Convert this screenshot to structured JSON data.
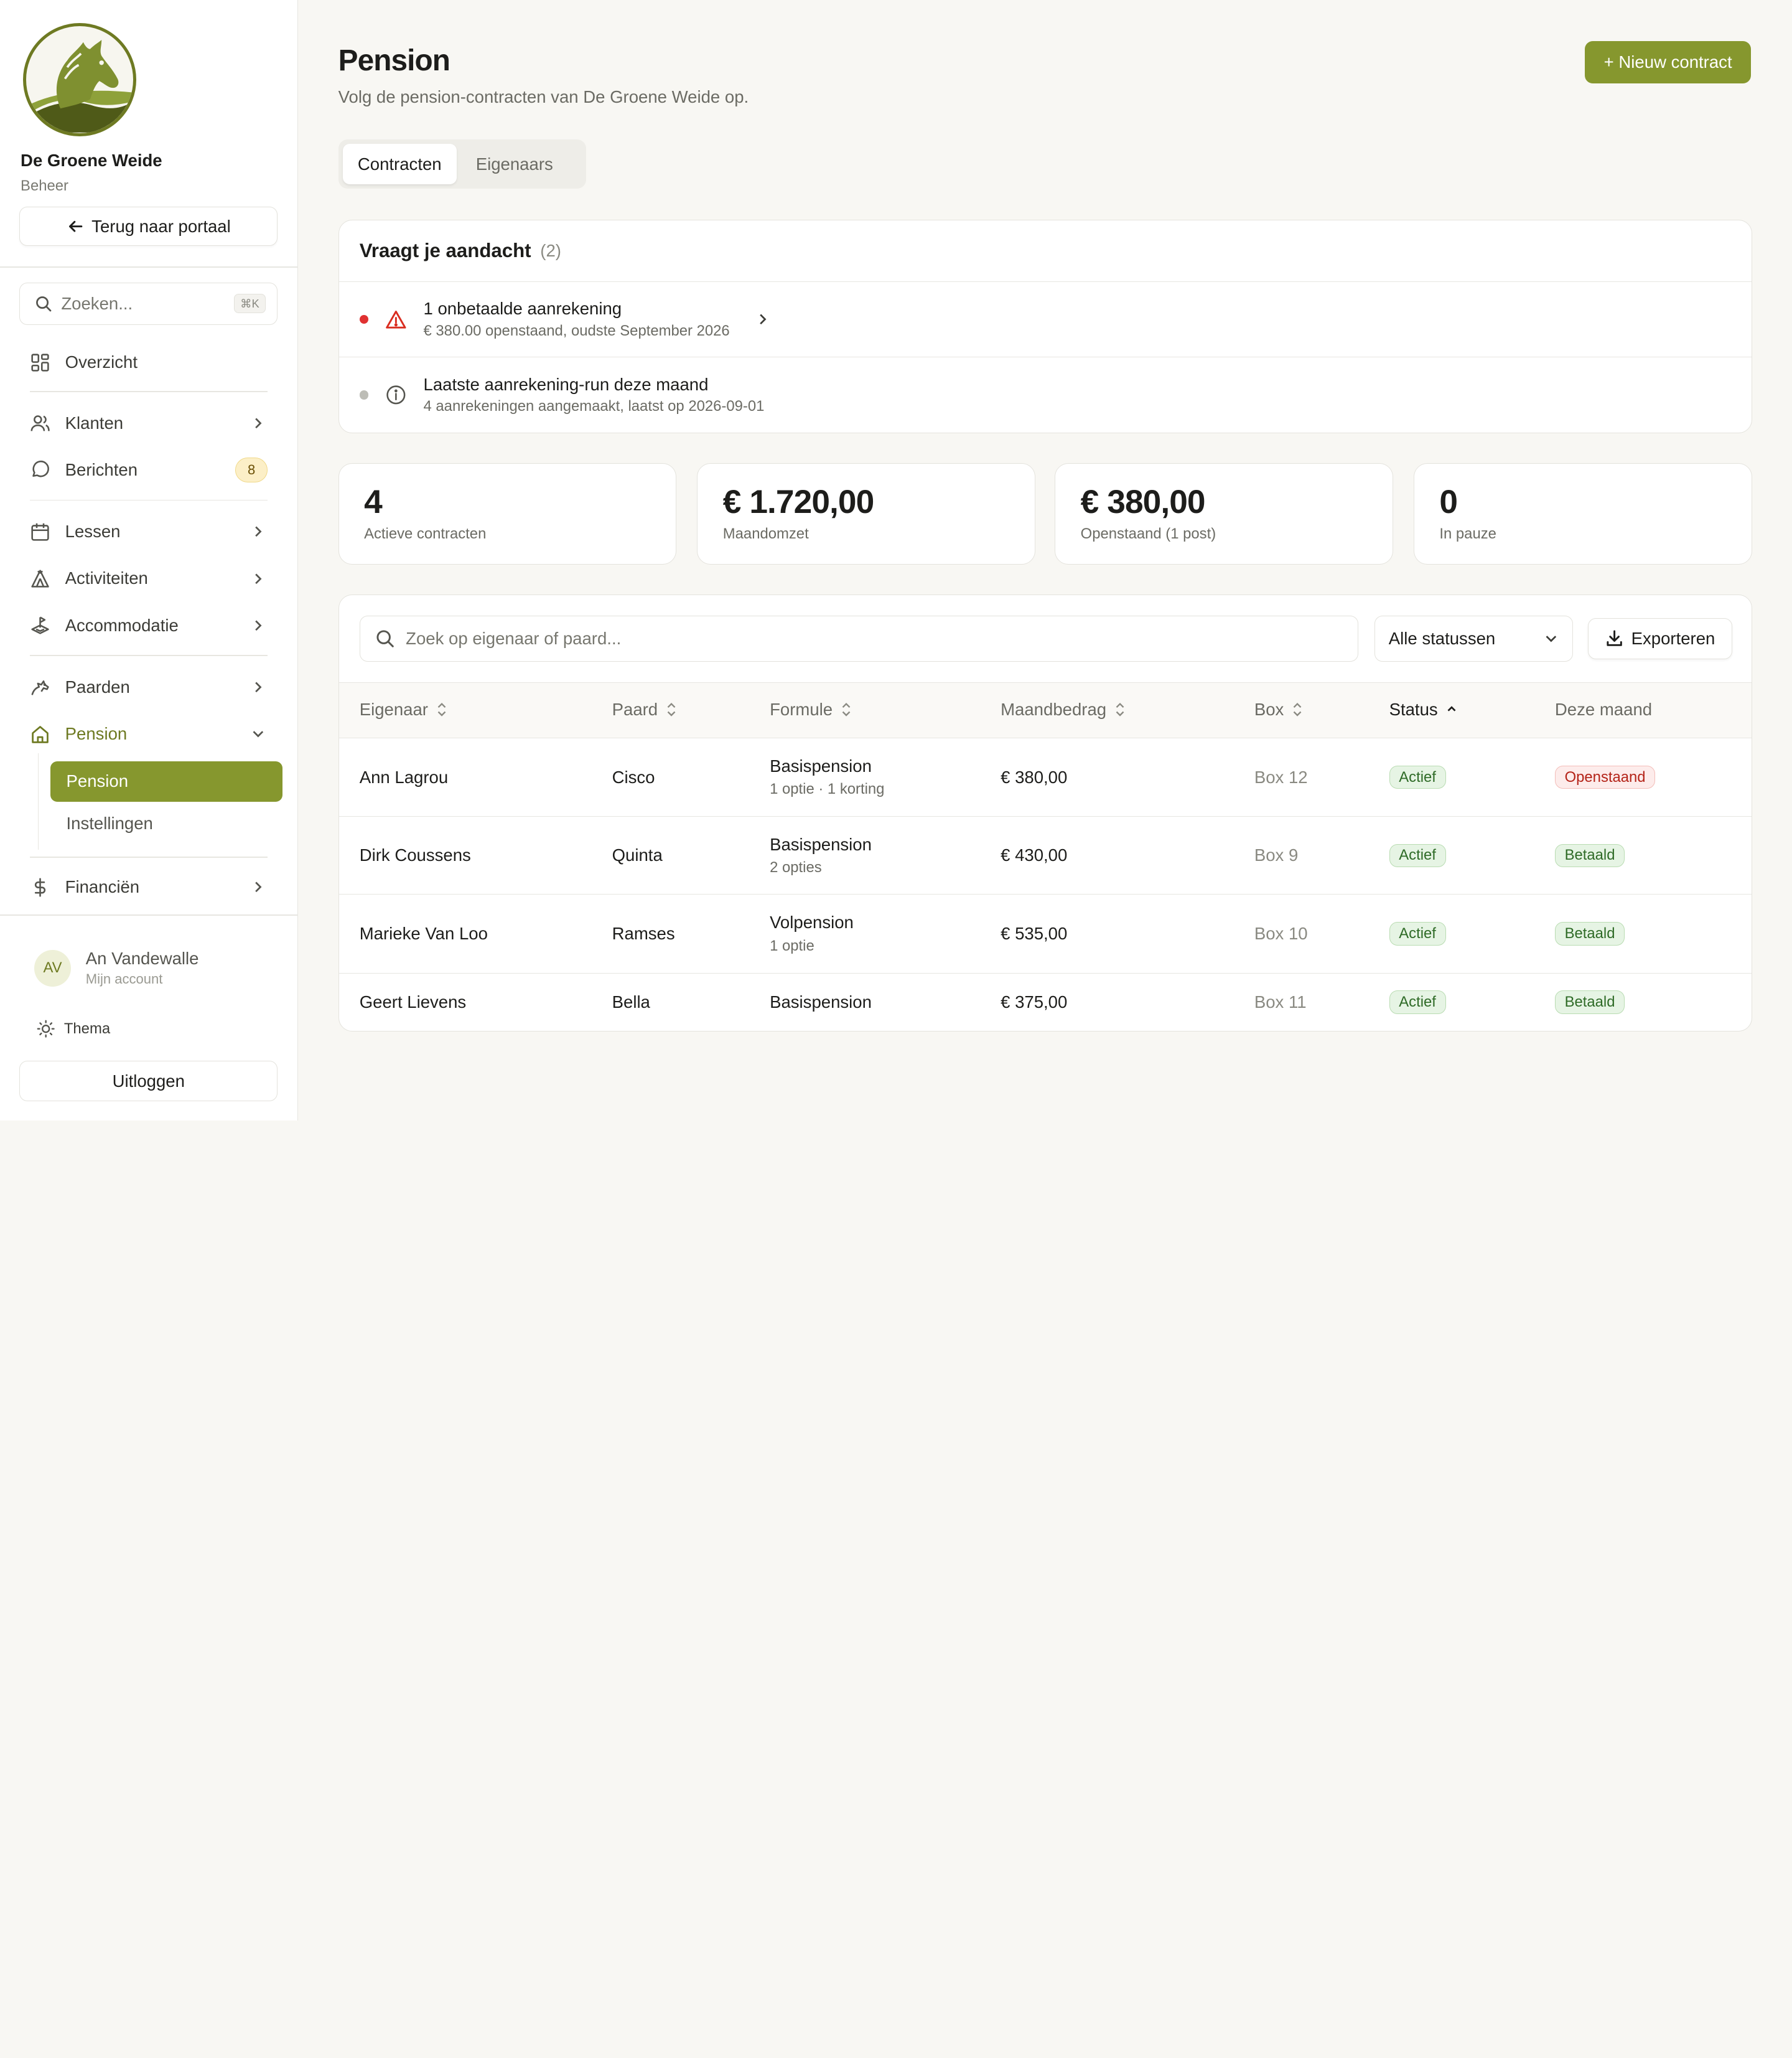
{
  "sidebar": {
    "org_name": "De Groene Weide",
    "org_role": "Beheer",
    "back_label": "Terug naar portaal",
    "search_placeholder": "Zoeken...",
    "search_shortcut": "⌘K",
    "nav": {
      "overview": "Overzicht",
      "clients": "Klanten",
      "messages": "Berichten",
      "messages_badge": "8",
      "lessons": "Lessen",
      "activities": "Activiteiten",
      "accommodation": "Accommodatie",
      "horses": "Paarden",
      "pension": "Pension",
      "pension_sub": [
        "Pension",
        "Instellingen"
      ],
      "finance": "Financiën"
    },
    "account": {
      "initials": "AV",
      "name": "An Vandewalle",
      "sub": "Mijn account"
    },
    "theme_label": "Thema",
    "logout_label": "Uitloggen"
  },
  "header": {
    "title": "Pension",
    "subtitle": "Volg de pension-contracten van De Groene Weide op.",
    "new_button": "+ Nieuw contract"
  },
  "tabs": [
    "Contracten",
    "Eigenaars"
  ],
  "attention": {
    "title": "Vraagt je aandacht",
    "count": "(2)",
    "items": [
      {
        "title": "1 onbetaalde aanrekening",
        "desc": "€ 380.00 openstaand, oudste September 2026"
      },
      {
        "title": "Laatste aanrekening-run deze maand",
        "desc": "4 aanrekeningen aangemaakt, laatst op 2026-09-01"
      }
    ]
  },
  "stats": [
    {
      "value": "4",
      "label": "Actieve contracten"
    },
    {
      "value": "€ 1.720,00",
      "label": "Maandomzet"
    },
    {
      "value": "€ 380,00",
      "label": "Openstaand (1 post)"
    },
    {
      "value": "0",
      "label": "In pauze"
    }
  ],
  "table": {
    "search_placeholder": "Zoek op eigenaar of paard...",
    "status_filter": "Alle statussen",
    "export_label": "Exporteren",
    "columns": [
      "Eigenaar",
      "Paard",
      "Formule",
      "Maandbedrag",
      "Box",
      "Status",
      "Deze maand"
    ],
    "rows": [
      {
        "owner": "Ann Lagrou",
        "horse": "Cisco",
        "formula": "Basispension",
        "formula_sub": "1 optie · 1 korting",
        "amount": "€ 380,00",
        "box": "Box 12",
        "status": "Actief",
        "month": "Openstaand"
      },
      {
        "owner": "Dirk Coussens",
        "horse": "Quinta",
        "formula": "Basispension",
        "formula_sub": "2 opties",
        "amount": "€ 430,00",
        "box": "Box 9",
        "status": "Actief",
        "month": "Betaald"
      },
      {
        "owner": "Marieke Van Loo",
        "horse": "Ramses",
        "formula": "Volpension",
        "formula_sub": "1 optie",
        "amount": "€ 535,00",
        "box": "Box 10",
        "status": "Actief",
        "month": "Betaald"
      },
      {
        "owner": "Geert Lievens",
        "horse": "Bella",
        "formula": "Basispension",
        "formula_sub": "",
        "amount": "€ 375,00",
        "box": "Box 11",
        "status": "Actief",
        "month": "Betaald"
      }
    ]
  },
  "colors": {
    "accent": "#86972e",
    "accent_dark": "#6e7a22",
    "background": "#f8f7f3",
    "success": "#2f6b27",
    "danger": "#b42318"
  }
}
